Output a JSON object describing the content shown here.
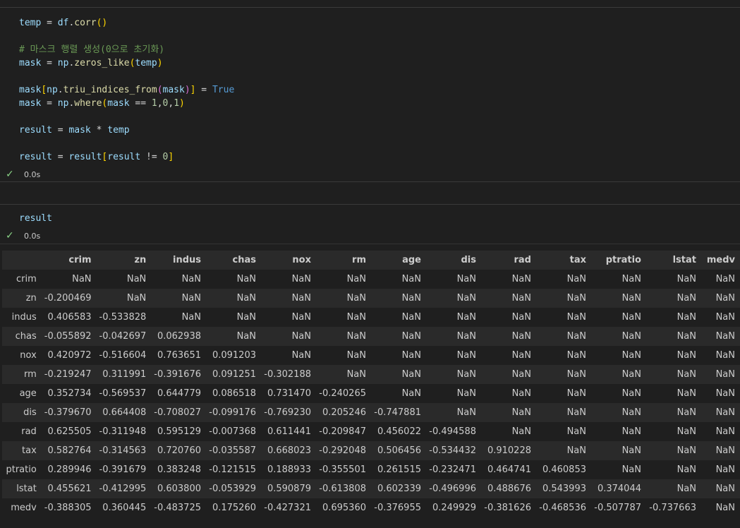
{
  "cell1": {
    "lines": [
      [
        [
          "t-var",
          "temp"
        ],
        [
          "t-op",
          " = "
        ],
        [
          "t-var",
          "df"
        ],
        [
          "t-op",
          "."
        ],
        [
          "t-fn",
          "corr"
        ],
        [
          "t-br1",
          "()"
        ]
      ],
      [],
      [
        [
          "t-com",
          "# 마스크 행렬 생성(0으로 초기화)"
        ]
      ],
      [
        [
          "t-var",
          "mask"
        ],
        [
          "t-op",
          " = "
        ],
        [
          "t-var",
          "np"
        ],
        [
          "t-op",
          "."
        ],
        [
          "t-fn",
          "zeros_like"
        ],
        [
          "t-br1",
          "("
        ],
        [
          "t-var",
          "temp"
        ],
        [
          "t-br1",
          ")"
        ]
      ],
      [],
      [
        [
          "t-var",
          "mask"
        ],
        [
          "t-br1",
          "["
        ],
        [
          "t-var",
          "np"
        ],
        [
          "t-op",
          "."
        ],
        [
          "t-fn",
          "triu_indices_from"
        ],
        [
          "t-br2",
          "("
        ],
        [
          "t-var",
          "mask"
        ],
        [
          "t-br2",
          ")"
        ],
        [
          "t-br1",
          "]"
        ],
        [
          "t-op",
          " = "
        ],
        [
          "t-kw",
          "True"
        ]
      ],
      [
        [
          "t-var",
          "mask"
        ],
        [
          "t-op",
          " = "
        ],
        [
          "t-var",
          "np"
        ],
        [
          "t-op",
          "."
        ],
        [
          "t-fn",
          "where"
        ],
        [
          "t-br1",
          "("
        ],
        [
          "t-var",
          "mask"
        ],
        [
          "t-op",
          " == "
        ],
        [
          "t-num",
          "1"
        ],
        [
          "t-plain",
          ","
        ],
        [
          "t-num",
          "0"
        ],
        [
          "t-plain",
          ","
        ],
        [
          "t-num",
          "1"
        ],
        [
          "t-br1",
          ")"
        ]
      ],
      [],
      [
        [
          "t-var",
          "result"
        ],
        [
          "t-op",
          " = "
        ],
        [
          "t-var",
          "mask"
        ],
        [
          "t-op",
          " * "
        ],
        [
          "t-var",
          "temp"
        ]
      ],
      [],
      [
        [
          "t-var",
          "result"
        ],
        [
          "t-op",
          " = "
        ],
        [
          "t-var",
          "result"
        ],
        [
          "t-br1",
          "["
        ],
        [
          "t-var",
          "result"
        ],
        [
          "t-op",
          " != "
        ],
        [
          "t-num",
          "0"
        ],
        [
          "t-br1",
          "]"
        ]
      ]
    ],
    "status_time": "0.0s"
  },
  "cell2": {
    "lines": [
      [
        [
          "t-var",
          "result"
        ]
      ]
    ],
    "status_time": "0.0s"
  },
  "status_icon": "check-icon",
  "table": {
    "columns": [
      "crim",
      "zn",
      "indus",
      "chas",
      "nox",
      "rm",
      "age",
      "dis",
      "rad",
      "tax",
      "ptratio",
      "lstat",
      "medv"
    ],
    "rows": [
      {
        "index": "crim",
        "values": [
          "NaN",
          "NaN",
          "NaN",
          "NaN",
          "NaN",
          "NaN",
          "NaN",
          "NaN",
          "NaN",
          "NaN",
          "NaN",
          "NaN",
          "NaN"
        ]
      },
      {
        "index": "zn",
        "values": [
          "-0.200469",
          "NaN",
          "NaN",
          "NaN",
          "NaN",
          "NaN",
          "NaN",
          "NaN",
          "NaN",
          "NaN",
          "NaN",
          "NaN",
          "NaN"
        ]
      },
      {
        "index": "indus",
        "values": [
          "0.406583",
          "-0.533828",
          "NaN",
          "NaN",
          "NaN",
          "NaN",
          "NaN",
          "NaN",
          "NaN",
          "NaN",
          "NaN",
          "NaN",
          "NaN"
        ]
      },
      {
        "index": "chas",
        "values": [
          "-0.055892",
          "-0.042697",
          "0.062938",
          "NaN",
          "NaN",
          "NaN",
          "NaN",
          "NaN",
          "NaN",
          "NaN",
          "NaN",
          "NaN",
          "NaN"
        ]
      },
      {
        "index": "nox",
        "values": [
          "0.420972",
          "-0.516604",
          "0.763651",
          "0.091203",
          "NaN",
          "NaN",
          "NaN",
          "NaN",
          "NaN",
          "NaN",
          "NaN",
          "NaN",
          "NaN"
        ]
      },
      {
        "index": "rm",
        "values": [
          "-0.219247",
          "0.311991",
          "-0.391676",
          "0.091251",
          "-0.302188",
          "NaN",
          "NaN",
          "NaN",
          "NaN",
          "NaN",
          "NaN",
          "NaN",
          "NaN"
        ]
      },
      {
        "index": "age",
        "values": [
          "0.352734",
          "-0.569537",
          "0.644779",
          "0.086518",
          "0.731470",
          "-0.240265",
          "NaN",
          "NaN",
          "NaN",
          "NaN",
          "NaN",
          "NaN",
          "NaN"
        ]
      },
      {
        "index": "dis",
        "values": [
          "-0.379670",
          "0.664408",
          "-0.708027",
          "-0.099176",
          "-0.769230",
          "0.205246",
          "-0.747881",
          "NaN",
          "NaN",
          "NaN",
          "NaN",
          "NaN",
          "NaN"
        ]
      },
      {
        "index": "rad",
        "values": [
          "0.625505",
          "-0.311948",
          "0.595129",
          "-0.007368",
          "0.611441",
          "-0.209847",
          "0.456022",
          "-0.494588",
          "NaN",
          "NaN",
          "NaN",
          "NaN",
          "NaN"
        ]
      },
      {
        "index": "tax",
        "values": [
          "0.582764",
          "-0.314563",
          "0.720760",
          "-0.035587",
          "0.668023",
          "-0.292048",
          "0.506456",
          "-0.534432",
          "0.910228",
          "NaN",
          "NaN",
          "NaN",
          "NaN"
        ]
      },
      {
        "index": "ptratio",
        "values": [
          "0.289946",
          "-0.391679",
          "0.383248",
          "-0.121515",
          "0.188933",
          "-0.355501",
          "0.261515",
          "-0.232471",
          "0.464741",
          "0.460853",
          "NaN",
          "NaN",
          "NaN"
        ]
      },
      {
        "index": "lstat",
        "values": [
          "0.455621",
          "-0.412995",
          "0.603800",
          "-0.053929",
          "0.590879",
          "-0.613808",
          "0.602339",
          "-0.496996",
          "0.488676",
          "0.543993",
          "0.374044",
          "NaN",
          "NaN"
        ]
      },
      {
        "index": "medv",
        "values": [
          "-0.388305",
          "0.360445",
          "-0.483725",
          "0.175260",
          "-0.427321",
          "0.695360",
          "-0.376955",
          "0.249929",
          "-0.381626",
          "-0.468536",
          "-0.507787",
          "-0.737663",
          "NaN"
        ]
      }
    ]
  }
}
